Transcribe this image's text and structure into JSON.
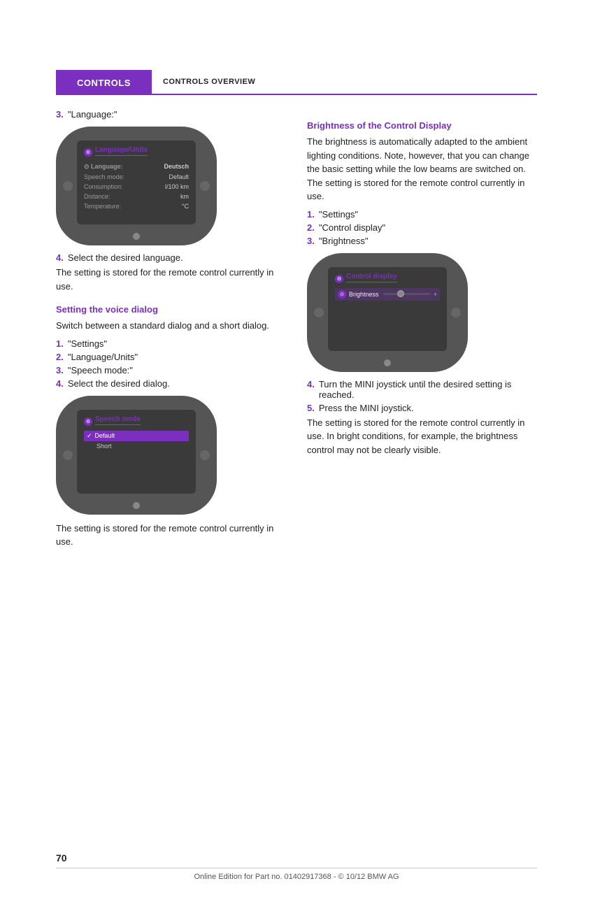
{
  "header": {
    "purple_tab": "CONTROLS",
    "section_title": "CONTROLS OVERVIEW"
  },
  "left_column": {
    "item3_label": "3.",
    "item3_text": "\"Language:\"",
    "device1": {
      "title": "Language/Units",
      "rows": [
        {
          "label": "Language:",
          "value": "Deutsch",
          "selected": true
        },
        {
          "label": "Speech mode:",
          "value": "Default"
        },
        {
          "label": "Consumption:",
          "value": "l/100 km"
        },
        {
          "label": "Distance:",
          "value": "km"
        },
        {
          "label": "Temperature:",
          "value": "°C"
        }
      ]
    },
    "item4_label": "4.",
    "item4_text": "Select the desired language.",
    "para1": "The setting is stored for the remote control currently in use.",
    "section_heading": "Setting the voice dialog",
    "para2": "Switch between a standard dialog and a short dialog.",
    "steps": [
      {
        "num": "1.",
        "text": "\"Settings\""
      },
      {
        "num": "2.",
        "text": "\"Language/Units\""
      },
      {
        "num": "3.",
        "text": "\"Speech mode:\""
      },
      {
        "num": "4.",
        "text": "Select the desired dialog."
      }
    ],
    "device2": {
      "title": "Speech mode",
      "rows": [
        {
          "label": "✓ Default",
          "selected": true
        },
        {
          "label": "Short",
          "selected": false
        }
      ]
    },
    "para3": "The setting is stored for the remote control currently in use."
  },
  "right_column": {
    "section_heading": "Brightness of the Control Display",
    "para1": "The brightness is automatically adapted to the ambient lighting conditions. Note, however, that you can change the basic setting while the low beams are switched on. The setting is stored for the remote control currently in use.",
    "steps": [
      {
        "num": "1.",
        "text": "\"Settings\""
      },
      {
        "num": "2.",
        "text": "\"Control display\""
      },
      {
        "num": "3.",
        "text": "\"Brightness\""
      }
    ],
    "device": {
      "title": "Control display",
      "brightness_label": "Brightness"
    },
    "step4_num": "4.",
    "step4_text": "Turn the MINI joystick until the desired setting is reached.",
    "step5_num": "5.",
    "step5_text": "Press the MINI joystick.",
    "para2": "The setting is stored for the remote control currently in use. In bright conditions, for example, the brightness control may not be clearly visible."
  },
  "footer": {
    "page_number": "70",
    "footer_text": "Online Edition for Part no. 01402917368 - © 10/12 BMW AG"
  }
}
